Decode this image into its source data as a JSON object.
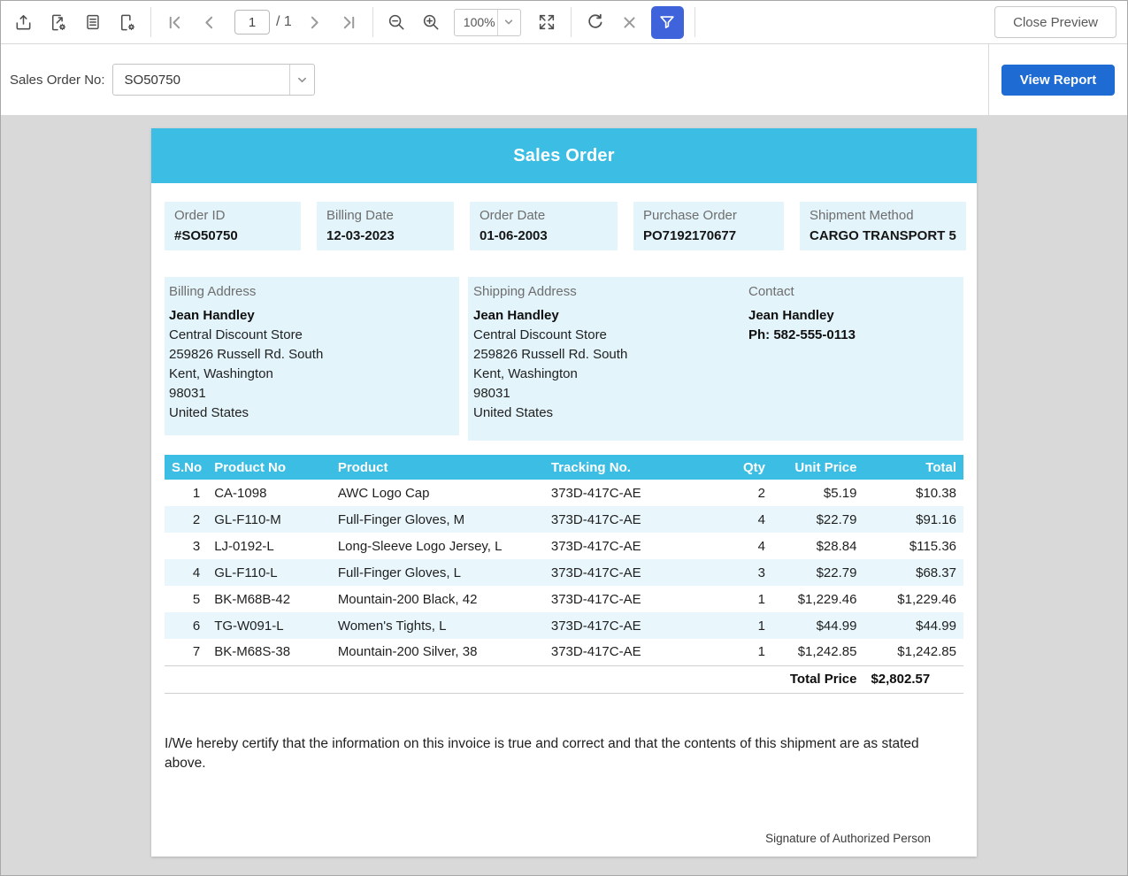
{
  "toolbar": {
    "close_preview_label": "Close Preview",
    "page": {
      "current": "1",
      "total": "/ 1"
    },
    "zoom_value": "100%",
    "icon_names": [
      "export-icon",
      "export-settings-icon",
      "print-layout-icon",
      "page-setup-icon",
      "first-page-icon",
      "previous-page-icon",
      "next-page-icon",
      "last-page-icon",
      "zoom-out-icon",
      "zoom-in-icon",
      "fit-to-page-icon",
      "refresh-icon",
      "cancel-icon",
      "filter-icon"
    ]
  },
  "parameters": {
    "label": "Sales Order No:",
    "selected_value": "SO50750",
    "view_report_label": "View Report"
  },
  "report": {
    "title": "Sales Order",
    "info_cards": [
      {
        "label": "Order ID",
        "value": "#SO50750"
      },
      {
        "label": "Billing Date",
        "value": "12-03-2023"
      },
      {
        "label": "Order Date",
        "value": "01-06-2003"
      },
      {
        "label": "Purchase Order",
        "value": "PO7192170677"
      },
      {
        "label": "Shipment Method",
        "value": "CARGO TRANSPORT 5"
      }
    ],
    "billing": {
      "label": "Billing Address",
      "name": "Jean Handley",
      "lines": [
        "Central Discount Store",
        "259826 Russell Rd. South",
        "Kent, Washington",
        "98031",
        "United States"
      ]
    },
    "shipping": {
      "label": "Shipping Address",
      "name": "Jean Handley",
      "lines": [
        "Central Discount Store",
        "259826 Russell Rd. South",
        "Kent, Washington",
        "98031",
        "United States"
      ]
    },
    "contact": {
      "label": "Contact",
      "name": "Jean Handley",
      "phone": "Ph: 582-555-0113"
    },
    "table": {
      "headers": [
        "S.No",
        "Product No",
        "Product",
        "Tracking No.",
        "Qty",
        "Unit Price",
        "Total"
      ],
      "rows": [
        [
          "1",
          "CA-1098",
          "AWC Logo Cap",
          "373D-417C-AE",
          "2",
          "$5.19",
          "$10.38"
        ],
        [
          "2",
          "GL-F110-M",
          "Full-Finger Gloves, M",
          "373D-417C-AE",
          "4",
          "$22.79",
          "$91.16"
        ],
        [
          "3",
          "LJ-0192-L",
          "Long-Sleeve Logo Jersey, L",
          "373D-417C-AE",
          "4",
          "$28.84",
          "$115.36"
        ],
        [
          "4",
          "GL-F110-L",
          "Full-Finger Gloves, L",
          "373D-417C-AE",
          "3",
          "$22.79",
          "$68.37"
        ],
        [
          "5",
          "BK-M68B-42",
          "Mountain-200 Black, 42",
          "373D-417C-AE",
          "1",
          "$1,229.46",
          "$1,229.46"
        ],
        [
          "6",
          "TG-W091-L",
          "Women's Tights, L",
          "373D-417C-AE",
          "1",
          "$44.99",
          "$44.99"
        ],
        [
          "7",
          "BK-M68S-38",
          "Mountain-200 Silver, 38",
          "373D-417C-AE",
          "1",
          "$1,242.85",
          "$1,242.85"
        ]
      ],
      "total_label": "Total Price",
      "total_value": "$2,802.57"
    },
    "certify_text": "I/We hereby certify that the information on this invoice is true and correct and that the contents of this shipment are as stated above.",
    "signature_label": "Signature of Authorized Person"
  },
  "colors": {
    "brand_cyan": "#3CBDE3",
    "card_bg": "#E3F4FB",
    "row_alt_bg": "#E9F7FD",
    "view_report_blue": "#1E6BD4",
    "filter_blue": "#3E63DA",
    "content_bg": "#D9D9D9"
  }
}
